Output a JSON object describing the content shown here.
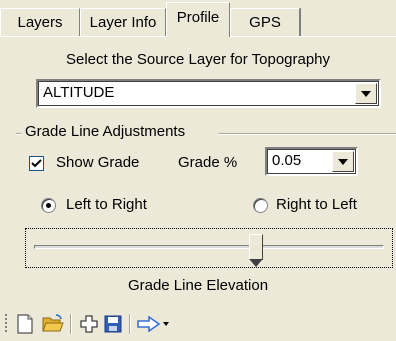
{
  "tabs": [
    {
      "label": "Layers"
    },
    {
      "label": "Layer Info"
    },
    {
      "label": "Profile",
      "active": true
    },
    {
      "label": "GPS"
    }
  ],
  "profile": {
    "source_prompt": "Select the Source Layer for Topography",
    "source_layer": "ALTITUDE",
    "group_title": "Grade Line Adjustments",
    "show_grade_label": "Show Grade",
    "show_grade_checked": true,
    "grade_label": "Grade %",
    "grade_value": "0.05",
    "left_to_right_label": "Left to Right",
    "right_to_left_label": "Right to Left",
    "direction_selected": "Left to Right",
    "slider_level": 0.64,
    "slider_caption": "Grade  Line  Elevation"
  },
  "toolbar": {
    "buttons": [
      {
        "icon": "new-document-icon"
      },
      {
        "icon": "open-folder-icon"
      },
      {
        "icon": "add-plus-icon"
      },
      {
        "icon": "save-disk-icon"
      },
      {
        "icon": "arrow-pointer-icon",
        "has_dropdown": true
      }
    ]
  },
  "colors": {
    "panel_bg": "#ece9d8",
    "folder_yellow": "#f2c94c",
    "save_blue": "#2f5fb5",
    "arrow_blue": "#3a6fd8"
  }
}
